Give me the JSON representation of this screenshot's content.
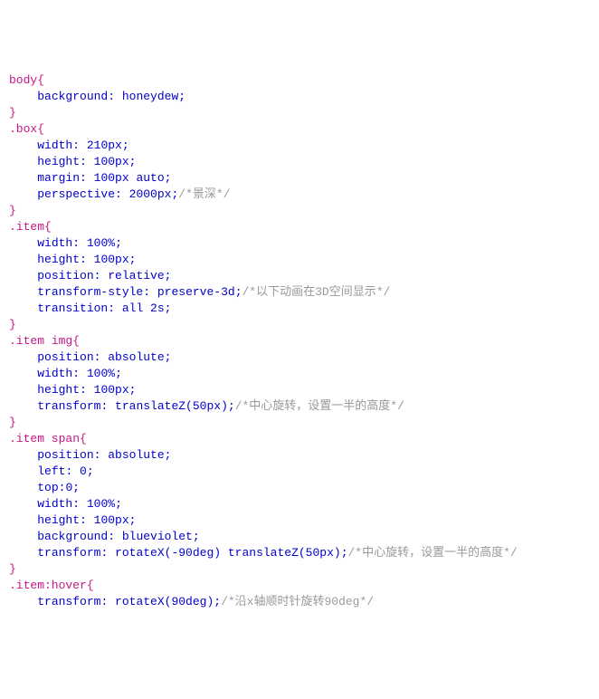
{
  "rules": [
    {
      "selector": "body",
      "decls": [
        {
          "prop": "background",
          "val": "honeydew",
          "comment": ""
        }
      ]
    },
    {
      "selector": ".box",
      "decls": [
        {
          "prop": "width",
          "val": "210px",
          "comment": ""
        },
        {
          "prop": "height",
          "val": "100px",
          "comment": ""
        },
        {
          "prop": "margin",
          "val": "100px auto",
          "comment": ""
        },
        {
          "prop": "perspective",
          "val": "2000px",
          "comment": "/*景深*/"
        }
      ]
    },
    {
      "selector": ".item",
      "decls": [
        {
          "prop": "width",
          "val": "100%",
          "comment": ""
        },
        {
          "prop": "height",
          "val": "100px",
          "comment": ""
        },
        {
          "prop": "position",
          "val": "relative",
          "comment": ""
        },
        {
          "prop": "transform-style",
          "val": "preserve-3d",
          "comment": "/*以下动画在3D空间显示*/"
        },
        {
          "prop": "transition",
          "val": "all 2s",
          "comment": ""
        }
      ]
    },
    {
      "selector": ".item img",
      "decls": [
        {
          "prop": "position",
          "val": "absolute",
          "comment": ""
        },
        {
          "prop": "width",
          "val": "100%",
          "comment": ""
        },
        {
          "prop": "height",
          "val": "100px",
          "comment": ""
        },
        {
          "prop": "transform",
          "val": "translateZ(50px)",
          "comment": "/*中心旋转，设置一半的高度*/"
        }
      ]
    },
    {
      "selector": ".item span",
      "decls": [
        {
          "prop": "position",
          "val": "absolute",
          "comment": ""
        },
        {
          "prop": "left",
          "val": "0",
          "comment": ""
        },
        {
          "prop": "top",
          "val": "0",
          "comment": ""
        },
        {
          "prop": "width",
          "val": "100%",
          "comment": ""
        },
        {
          "prop": "height",
          "val": "100px",
          "comment": ""
        },
        {
          "prop": "background",
          "val": "blueviolet",
          "comment": ""
        },
        {
          "prop": "transform",
          "val": "rotateX(-90deg) translateZ(50px)",
          "comment": "/*中心旋转，设置一半的高度*/"
        }
      ]
    },
    {
      "selector": ".item:hover",
      "decls": [
        {
          "prop": "transform",
          "val": "rotateX(90deg)",
          "comment": "/*沿x轴顺时针旋转90deg*/"
        }
      ],
      "noClose": true
    }
  ],
  "indent": "    "
}
